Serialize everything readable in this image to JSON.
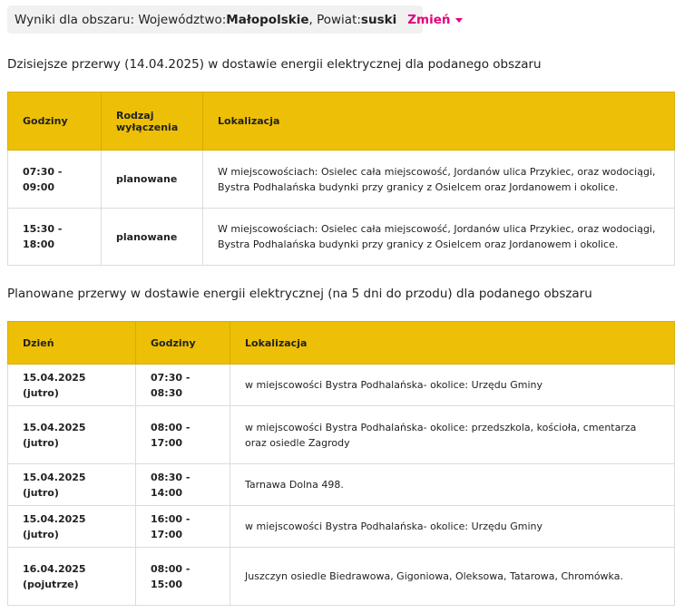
{
  "area": {
    "prefix": "Wyniki dla obszaru: Województwo: ",
    "voivodeship": "Małopolskie",
    "county_prefix": ", Powiat: ",
    "county": "suski",
    "change_label": "Zmień"
  },
  "today": {
    "title": "Dzisiejsze przerwy (14.04.2025) w dostawie energii elektrycznej dla podanego obszaru",
    "headers": {
      "hours": "Godziny",
      "type": "Rodzaj wyłączenia",
      "location": "Lokalizacja"
    },
    "rows": [
      {
        "hours": "07:30 - 09:00",
        "type": "planowane",
        "location": "W miejscowościach: Osielec cała miejscowość, Jordanów ulica Przykiec, oraz wodociągi, Bystra Podhalańska budynki przy granicy z Osielcem oraz Jordanowem i okolice."
      },
      {
        "hours": "15:30 - 18:00",
        "type": "planowane",
        "location": "W miejscowościach: Osielec cała miejscowość, Jordanów ulica Przykiec, oraz wodociągi, Bystra Podhalańska budynki przy granicy z Osielcem oraz Jordanowem i okolice."
      }
    ]
  },
  "planned": {
    "title": "Planowane przerwy w dostawie energii elektrycznej (na 5 dni do przodu) dla podanego obszaru",
    "headers": {
      "day": "Dzień",
      "hours": "Godziny",
      "location": "Lokalizacja"
    },
    "rows": [
      {
        "day": "15.04.2025 (jutro)",
        "hours": "07:30 - 08:30",
        "location": "w miejscowości Bystra Podhalańska- okolice: Urzędu Gminy"
      },
      {
        "day": "15.04.2025 (jutro)",
        "hours": "08:00 - 17:00",
        "location": "w miejscowości Bystra Podhalańska- okolice: przedszkola, kościoła, cmentarza oraz osiedle Zagrody"
      },
      {
        "day": "15.04.2025 (jutro)",
        "hours": "08:30 - 14:00",
        "location": "Tarnawa Dolna 498."
      },
      {
        "day": "15.04.2025 (jutro)",
        "hours": "16:00 - 17:00",
        "location": "w miejscowości Bystra Podhalańska- okolice: Urzędu Gminy"
      },
      {
        "day": "16.04.2025 (pojutrze)",
        "hours": "08:00 - 15:00",
        "location": "Juszczyn osiedle Biedrawowa, Gigoniowa, Oleksowa, Tatarowa, Chromówka."
      }
    ]
  },
  "colors": {
    "header_bg": "#edc007",
    "accent": "#e5007d",
    "bar_bg": "#f1f1f1"
  }
}
